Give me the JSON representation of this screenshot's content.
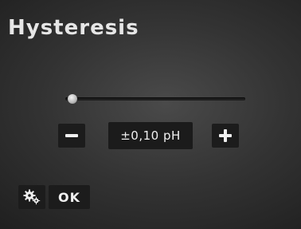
{
  "screen": {
    "title": "Hysteresis"
  },
  "slider": {
    "value_fraction": 0.04
  },
  "stepper": {
    "value": "±0,10 pH",
    "minus_icon": "minus-icon",
    "plus_icon": "plus-icon"
  },
  "footer": {
    "settings_icon": "gears-icon",
    "ok_label": "OK"
  },
  "colors": {
    "background": "#333333",
    "button": "#1c1c1c",
    "text": "#f0f0f0"
  }
}
